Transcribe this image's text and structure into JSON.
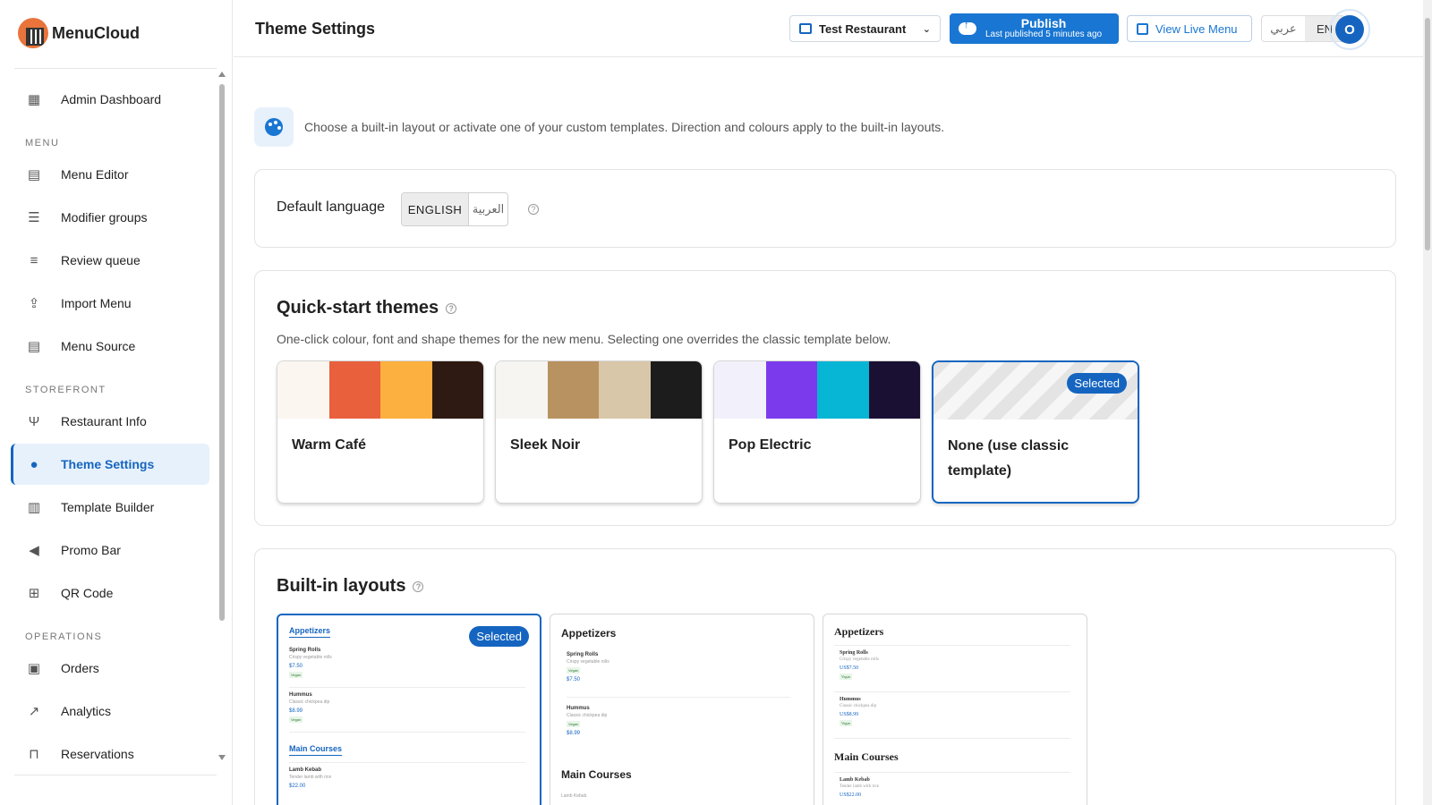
{
  "brand": {
    "name": "MenuCloud"
  },
  "sidebar": {
    "top_item": {
      "label": "Admin Dashboard"
    },
    "sections": [
      {
        "title": "MENU",
        "items": [
          {
            "label": "Menu Editor",
            "icon": "book-icon"
          },
          {
            "label": "Modifier groups",
            "icon": "sliders-icon"
          },
          {
            "label": "Review queue",
            "icon": "checklist-icon"
          },
          {
            "label": "Import Menu",
            "icon": "file-upload-icon"
          },
          {
            "label": "Menu Source",
            "icon": "book-icon"
          }
        ]
      },
      {
        "title": "STOREFRONT",
        "items": [
          {
            "label": "Restaurant Info",
            "icon": "utensils-icon"
          },
          {
            "label": "Theme Settings",
            "icon": "palette-icon",
            "active": true
          },
          {
            "label": "Template Builder",
            "icon": "layout-icon"
          },
          {
            "label": "Promo Bar",
            "icon": "megaphone-icon"
          },
          {
            "label": "QR Code",
            "icon": "qr-code-icon"
          }
        ]
      },
      {
        "title": "OPERATIONS",
        "items": [
          {
            "label": "Orders",
            "icon": "receipt-icon"
          },
          {
            "label": "Analytics",
            "icon": "trending-icon"
          },
          {
            "label": "Reservations",
            "icon": "chair-icon"
          }
        ]
      }
    ]
  },
  "header": {
    "title": "Theme Settings",
    "restaurant": "Test Restaurant",
    "publish_label": "Publish",
    "publish_status": "Last published 5 minutes ago",
    "view_live_label": "View Live Menu",
    "lang_ar": "عربي",
    "lang_en": "EN",
    "avatar_initial": "O"
  },
  "intro": {
    "text": "Choose a built-in layout or activate one of your custom templates. Direction and colours apply to the built-in layouts."
  },
  "default_language": {
    "label": "Default language",
    "option_en": "ENGLISH",
    "option_ar": "العربية",
    "selected": "ENGLISH"
  },
  "quick_start": {
    "title": "Quick-start themes",
    "subtitle": "One-click colour, font and shape themes for the new menu. Selecting one overrides the classic template below.",
    "themes": [
      {
        "name": "Warm Café",
        "swatches": [
          "#fbf6f0",
          "#e8603c",
          "#fbb040",
          "#2e1a12"
        ]
      },
      {
        "name": "Sleek Noir",
        "swatches": [
          "#f6f5f2",
          "#b89260",
          "#d8c7a8",
          "#1c1c1c"
        ]
      },
      {
        "name": "Pop Electric",
        "swatches": [
          "#f2f1fb",
          "#7c3aed",
          "#06b6d4",
          "#1a1033"
        ]
      },
      {
        "name": "None (use classic template)",
        "swatches": [],
        "selected": true
      }
    ],
    "selected_badge": "Selected"
  },
  "layouts": {
    "title": "Built-in layouts",
    "selected_badge": "Selected",
    "tiles": [
      {
        "selected": true,
        "section1": "Appetizers",
        "section2": "Main Courses",
        "items": [
          {
            "name": "Spring Rolls",
            "desc": "Crispy vegetable rolls",
            "price": "$7.50",
            "tag": "Vegan"
          },
          {
            "name": "Hummus",
            "desc": "Classic chickpea dip",
            "price": "$8.99",
            "tag": "Vegan"
          },
          {
            "name": "Lamb Kebab",
            "desc": "Tender lamb with rice",
            "price": "$22.00"
          }
        ]
      },
      {
        "selected": false,
        "section1": "Appetizers",
        "section2": "Main Courses",
        "items": [
          {
            "name": "Spring Rolls",
            "desc": "Crispy vegetable rolls",
            "price": "$7.50",
            "tag": "Vegan"
          },
          {
            "name": "Hummus",
            "desc": "Classic chickpea dip",
            "price": "$8.99",
            "tag": "Vegan"
          },
          {
            "name": "Lamb Kebab",
            "desc": "",
            "price": ""
          }
        ]
      },
      {
        "selected": false,
        "section1": "Appetizers",
        "section2": "Main Courses",
        "items": [
          {
            "name": "Spring Rolls",
            "desc": "Crispy vegetable rolls",
            "price": "US$7.50",
            "tag": "Vegan"
          },
          {
            "name": "Hummus",
            "desc": "Classic chickpea dip",
            "price": "US$8.99",
            "tag": "Vegan"
          },
          {
            "name": "Lamb Kebab",
            "desc": "Tender lamb with rice",
            "price": "US$22.00"
          }
        ]
      }
    ]
  }
}
